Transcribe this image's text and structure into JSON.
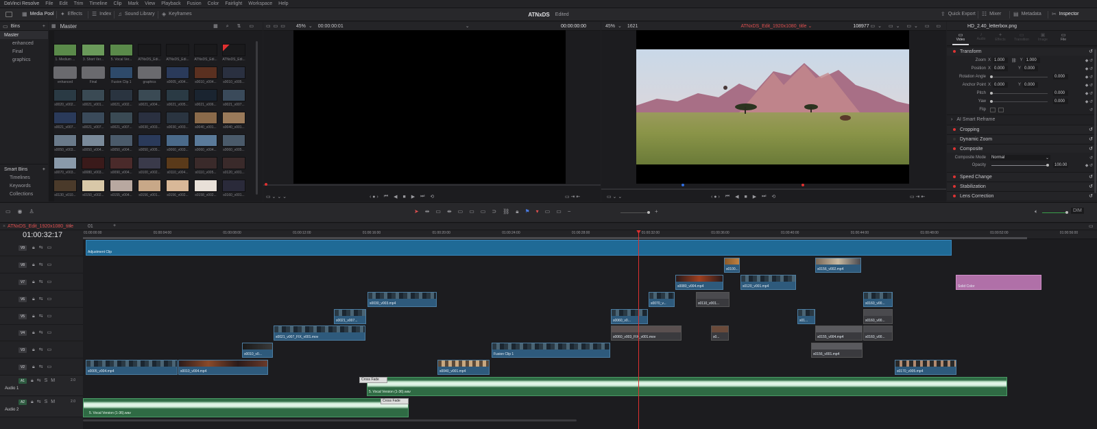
{
  "menu": [
    "DaVinci Resolve",
    "File",
    "Edit",
    "Trim",
    "Timeline",
    "Clip",
    "Mark",
    "View",
    "Playback",
    "Fusion",
    "Color",
    "Fairlight",
    "Workspace",
    "Help"
  ],
  "toolbar": {
    "left": [
      {
        "icon": "media-pool-icon",
        "label": "Media Pool"
      },
      {
        "icon": "effects-icon",
        "label": "Effects"
      },
      {
        "icon": "index-icon",
        "label": "Index"
      },
      {
        "icon": "sound-library-icon",
        "label": "Sound Library"
      },
      {
        "icon": "keyframes-icon",
        "label": "Keyframes"
      }
    ],
    "project_title": "ATNxDS",
    "project_status": "Edited",
    "right": [
      {
        "icon": "quick-export-icon",
        "label": "Quick Export"
      },
      {
        "icon": "mixer-icon",
        "label": "Mixer"
      },
      {
        "icon": "metadata-icon",
        "label": "Metadata"
      },
      {
        "icon": "inspector-icon",
        "label": "Inspector"
      }
    ]
  },
  "bins": {
    "header": "Bins",
    "items": [
      "Master",
      "enhanced",
      "Final",
      "graphics"
    ],
    "smart_header": "Smart Bins",
    "smart_items": [
      "Timelines",
      "Keywords",
      "Collections"
    ]
  },
  "media_pool": {
    "header": "Master",
    "clips": [
      [
        "1. Medium ...",
        "3. Short Ver...",
        "5. Vocal Ver...",
        "ATNxDS_Edi...",
        "ATNxDS_Edi...",
        "ATNxDS_Edi...",
        "ATNxDS_Edi..."
      ],
      [
        "enhanced",
        "Final",
        "Fusion Clip 1",
        "graphics",
        "s0005_v004...",
        "s0010_v004...",
        "s0010_v005..."
      ],
      [
        "s0020_v002...",
        "s0021_v001...",
        "s0021_v002...",
        "s0021_v004...",
        "s0021_v005...",
        "s0021_v006...",
        "s0021_v007..."
      ],
      [
        "s0021_v007...",
        "s0021_v007...",
        "s0021_v007...",
        "s0030_v003...",
        "s0030_v003...",
        "s0040_v001...",
        "s0040_v001..."
      ],
      [
        "s0050_v003...",
        "s0050_v004...",
        "s0050_v004...",
        "s0050_v005...",
        "s0060_v003...",
        "s0060_v004...",
        "s0060_v005..."
      ],
      [
        "s0070_v003...",
        "s0080_v003...",
        "s0090_v004...",
        "s0100_v002...",
        "s0110_v004...",
        "s0110_v005...",
        "s0120_v001..."
      ],
      [
        "s0130_v010...",
        "s0150_v002...",
        "s0155_v004...",
        "s0156_v001...",
        "s0156_v002...",
        "s0158_v002...",
        "s0160_v001..."
      ]
    ]
  },
  "source_viewer": {
    "zoom": "45%",
    "timecode": "00:00:00:01",
    "duration": "00:00:00:00"
  },
  "timeline_viewer": {
    "zoom": "45%",
    "frame": "1621",
    "timeline_name": "ATNxDS_Edit_1920x1080_title",
    "frames": "108977"
  },
  "inspector": {
    "filename": "HD_2.40_letterbox.png",
    "tabs": [
      "Video",
      "Audio",
      "Effects",
      "Transition",
      "Image",
      "File"
    ],
    "transform_label": "Transform",
    "zoom_label": "Zoom",
    "zoom_x": "1.000",
    "zoom_y": "1.000",
    "position_label": "Position",
    "pos_x": "0.000",
    "pos_y": "0.000",
    "rotation_label": "Rotation Angle",
    "rotation": "0.000",
    "anchor_label": "Anchor Point",
    "anchor_x": "0.000",
    "anchor_y": "0.000",
    "pitch_label": "Pitch",
    "pitch": "0.000",
    "yaw_label": "Yaw",
    "yaw": "0.000",
    "flip_label": "Flip",
    "ai_reframe": "AI Smart Reframe",
    "cropping": "Cropping",
    "dynamic_zoom": "Dynamic Zoom",
    "composite": "Composite",
    "composite_mode_label": "Composite Mode",
    "composite_mode": "Normal",
    "opacity_label": "Opacity",
    "opacity": "100.00",
    "speed_change": "Speed Change",
    "stabilization": "Stabilization",
    "lens_correction": "Lens Correction"
  },
  "timeline": {
    "tab": "ATNxDS_Edit_1920x1080_title",
    "tab2": "01",
    "timecode": "01:00:32:17",
    "ruler": [
      "01:00:00:00",
      "01:00:04:00",
      "01:00:08:00",
      "01:00:12:00",
      "01:00:16:00",
      "01:00:20:00",
      "01:00:24:00",
      "01:00:28:00",
      "01:00:32:00",
      "01:00:36:00",
      "01:00:40:00",
      "01:00:44:00",
      "01:00:48:00",
      "01:00:52:00",
      "01:00:56:00"
    ],
    "video_tracks": [
      "V9",
      "V8",
      "V7",
      "V6",
      "V5",
      "V4",
      "V3",
      "V2"
    ],
    "audio_tracks": [
      {
        "id": "A1",
        "name": "Audio 1",
        "level": "2.0"
      },
      {
        "id": "A2",
        "name": "Audio 2",
        "level": "2.0"
      }
    ],
    "dim": "DIM",
    "clips": {
      "adjustment": "Adjustment Clip",
      "solid": "Solid Color",
      "v8a": "s0100...",
      "v8b": "s0156_v002.mp4",
      "v7a": "s0080_v004.mp4",
      "v7b": "s0120_v001.mp4",
      "v6a": "s0030_v003.mp4",
      "v6b": "s0070_v...",
      "v6c": "s0110_v001...",
      "v6d": "s0160_v00...",
      "v5a": "s0021_v007...",
      "v5b": "s0060_v0...",
      "v5c": "s01...",
      "v5d": "s0160_v00...",
      "v4a": "s0021_v007_FIX_v001.mov",
      "v4b": "s0060_v003_FIX_v001.mov",
      "v4c": "s0...",
      "v4d": "s0155_v004.mp4",
      "v4e": "s0160_v00...",
      "v3a": "s0010_v0...",
      "v3b": "Fusion Clip 1",
      "v3c": "s0156_v001.mp4",
      "v2a": "s0005_v004.mp4",
      "v2b": "s0010_v004.mp4",
      "v2c": "s0040_v001.mp4",
      "v2d": "s0170_v005.mp4",
      "a1": "5. Vocal Version (1-36).wav",
      "a2": "5. Vocal Version (1-36).wav",
      "crossfade": "Cross Fade"
    }
  }
}
